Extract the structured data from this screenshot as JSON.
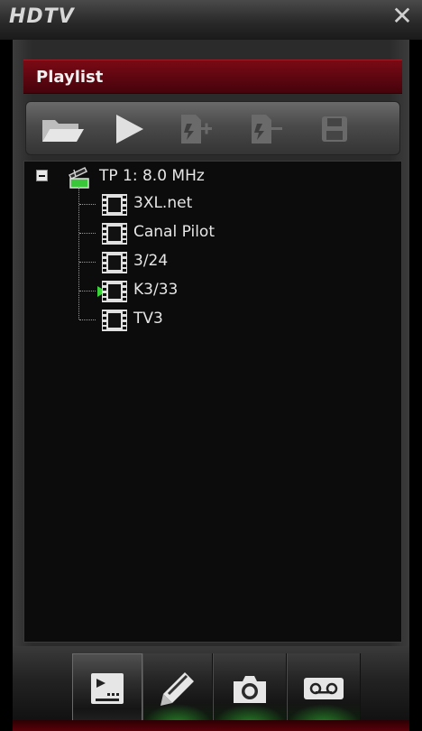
{
  "window": {
    "title": "HDTV",
    "close_glyph": "✕"
  },
  "playlist": {
    "header": "Playlist",
    "toolbar": [
      {
        "name": "open-folder-icon",
        "enabled": true
      },
      {
        "name": "play-icon",
        "enabled": true
      },
      {
        "name": "add-channel-icon",
        "enabled": false
      },
      {
        "name": "remove-channel-icon",
        "enabled": false
      },
      {
        "name": "save-icon",
        "enabled": false
      }
    ],
    "tree": {
      "root": {
        "label": "TP 1: 8.0 MHz",
        "expander": "−"
      },
      "channels": [
        {
          "label": "3XL.net",
          "playing": false
        },
        {
          "label": "Canal Pilot",
          "playing": false
        },
        {
          "label": "3/24",
          "playing": false
        },
        {
          "label": "K3/33",
          "playing": true
        },
        {
          "label": "TV3",
          "playing": false
        }
      ]
    }
  },
  "tabs": [
    {
      "name": "playlist-icon",
      "active": true
    },
    {
      "name": "edit-icon",
      "active": false
    },
    {
      "name": "camera-icon",
      "active": false
    },
    {
      "name": "record-tape-icon",
      "active": false
    }
  ],
  "colors": {
    "header_red": "#5a0610",
    "playing_green": "#3ad43a",
    "tab_glow": "#3cc83c"
  }
}
